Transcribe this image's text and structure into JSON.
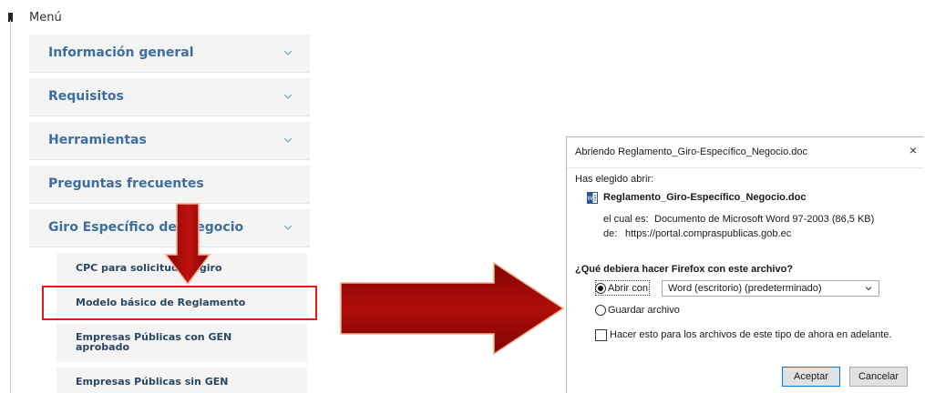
{
  "menu": {
    "title": "Menú",
    "items": [
      {
        "label": "Información general",
        "has_chevron": true
      },
      {
        "label": "Requisitos",
        "has_chevron": true
      },
      {
        "label": "Herramientas",
        "has_chevron": true
      },
      {
        "label": "Preguntas frecuentes",
        "has_chevron": false
      },
      {
        "label": "Giro Específico del Negocio",
        "has_chevron": true
      }
    ],
    "subitems": [
      {
        "label": "CPC para solicitud de giro"
      },
      {
        "label": "Modelo básico de Reglamento"
      },
      {
        "label_line1": "Empresas Públicas con GEN",
        "label_line2": "aprobado"
      },
      {
        "label": "Empresas Públicas sin GEN"
      }
    ]
  },
  "colors": {
    "menu_text": "#3c6e9f",
    "highlight": "#e2181b",
    "arrow_fill": "#a00a08",
    "arrow_outline": "#f2b08a",
    "button_focus": "#0078d7"
  },
  "dialog": {
    "title": "Abriendo Reglamento_Giro-Específico_Negocio.doc",
    "close_icon": "×",
    "chosen_label": "Has elegido abrir:",
    "file_icon": "word-document-icon",
    "file_name": "Reglamento_Giro-Específico_Negocio.doc",
    "type_label": "el cual es:",
    "type_value": "Documento de Microsoft Word 97-2003 (86,5 KB)",
    "from_label": "de:",
    "from_value": "https://portal.compraspublicas.gob.ec",
    "question": "¿Qué debiera hacer Firefox con este archivo?",
    "open_with_label": "Abrir con",
    "open_with_value": "Word (escritorio) (predeterminado)",
    "save_label": "Guardar archivo",
    "remember_label": "Hacer esto para los archivos de este tipo de ahora en adelante.",
    "accept_label": "Aceptar",
    "cancel_label": "Cancelar"
  }
}
